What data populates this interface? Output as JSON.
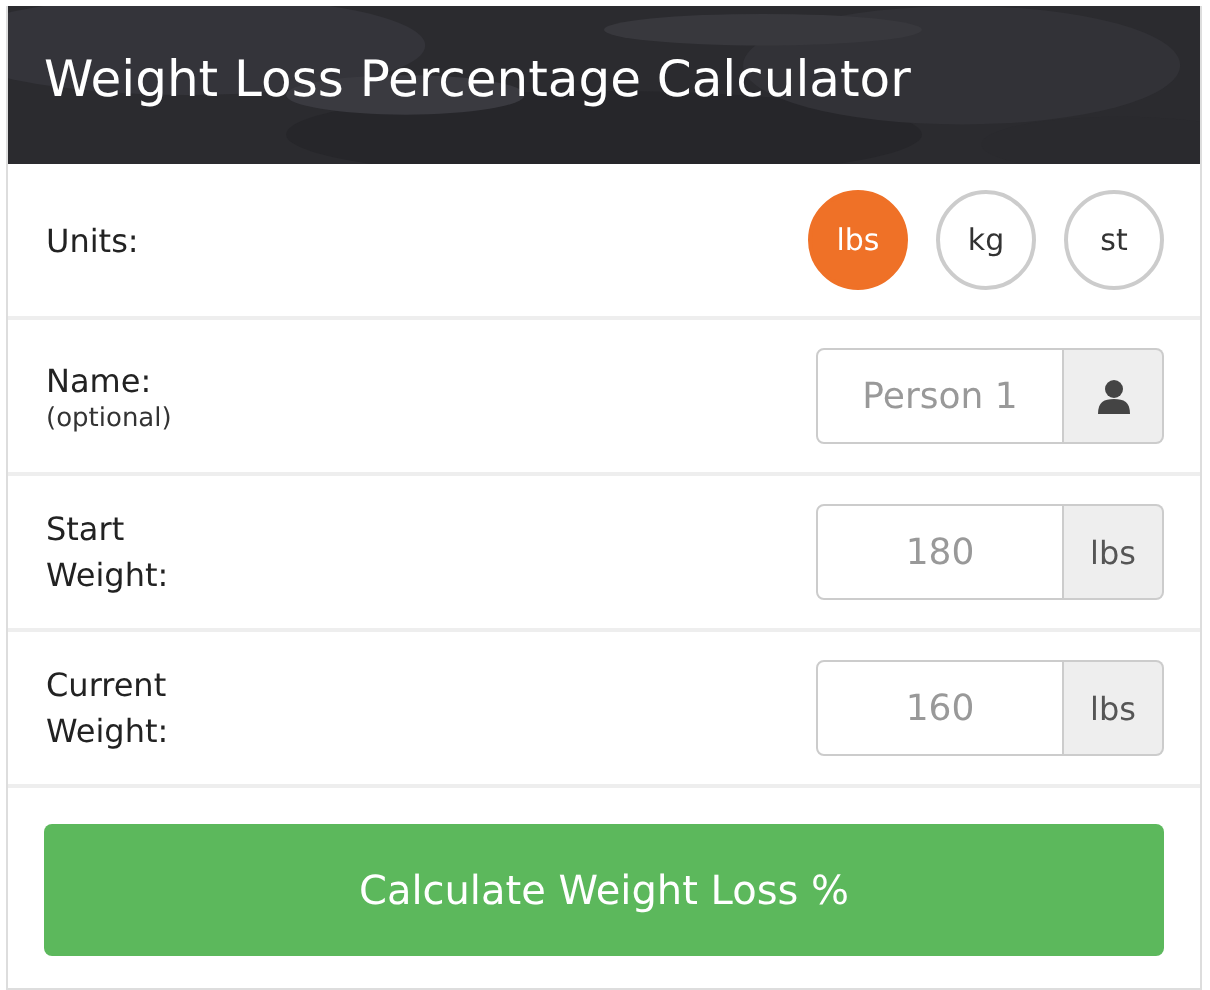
{
  "header": {
    "title": "Weight Loss Percentage Calculator"
  },
  "units": {
    "label": "Units:",
    "options": [
      {
        "label": "lbs",
        "selected": true
      },
      {
        "label": "kg",
        "selected": false
      },
      {
        "label": "st",
        "selected": false
      }
    ]
  },
  "fields": [
    {
      "kind": "person",
      "label": "Name:",
      "note": "(optional)",
      "placeholder": "Person 1"
    },
    {
      "kind": "weight",
      "label": "Start Weight:",
      "value": "180",
      "unit": "lbs"
    },
    {
      "kind": "weight",
      "label": "Current Weight:",
      "value": "160",
      "unit": "lbs"
    }
  ],
  "button": {
    "label": "Calculate Weight Loss %"
  }
}
